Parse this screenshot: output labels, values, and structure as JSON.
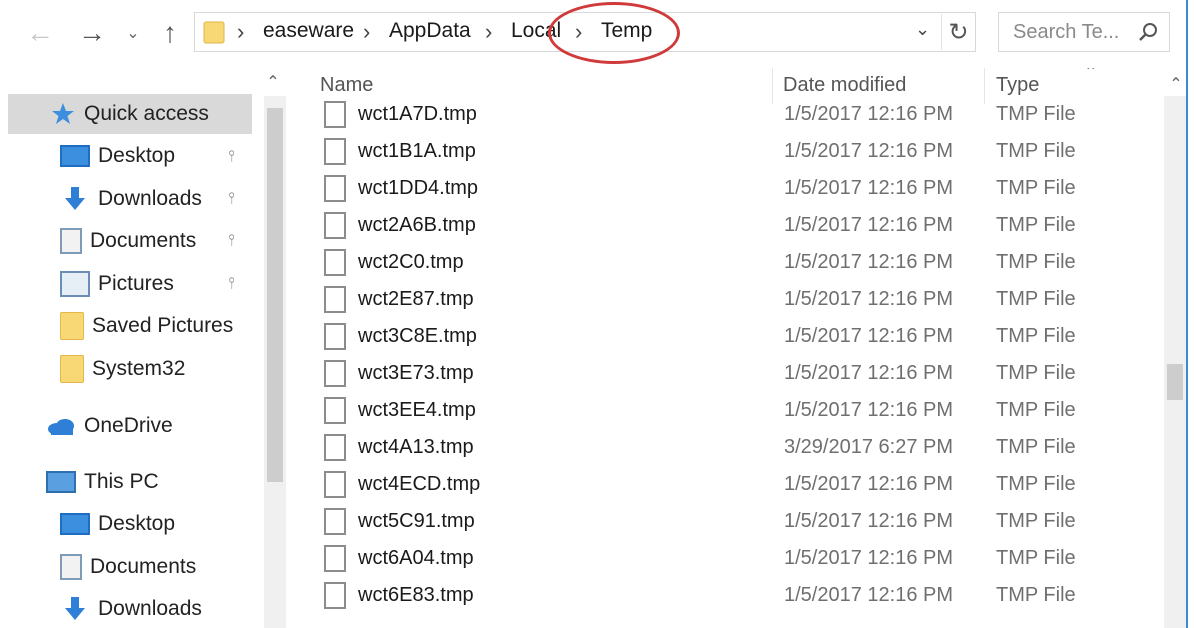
{
  "nav_buttons": {
    "back": "←",
    "forward": "→",
    "recent": "⌄",
    "up": "↑"
  },
  "address": {
    "crumbs": [
      "easeware",
      "AppData",
      "Local",
      "Temp"
    ],
    "separator": "›",
    "dropdown": "⌄",
    "refresh": "↻",
    "highlight_color": "#d03a3a"
  },
  "search": {
    "placeholder": "Search Te..."
  },
  "sidebar": {
    "quick_access": "Quick access",
    "items": [
      {
        "label": "Desktop",
        "icon": "desktop-icon",
        "pinned": true
      },
      {
        "label": "Downloads",
        "icon": "download-arrow-icon",
        "pinned": true
      },
      {
        "label": "Documents",
        "icon": "document-icon",
        "pinned": true
      },
      {
        "label": "Pictures",
        "icon": "pictures-icon",
        "pinned": true
      },
      {
        "label": "Saved Pictures",
        "icon": "folder-icon",
        "pinned": false
      },
      {
        "label": "System32",
        "icon": "folder-icon",
        "pinned": false
      }
    ],
    "onedrive": "OneDrive",
    "this_pc": "This PC",
    "pc_items": [
      {
        "label": "Desktop",
        "icon": "desktop-icon"
      },
      {
        "label": "Documents",
        "icon": "document-icon"
      },
      {
        "label": "Downloads",
        "icon": "download-arrow-icon"
      }
    ],
    "pin_glyph": "📌"
  },
  "columns": {
    "name": "Name",
    "date": "Date modified",
    "type": "Type"
  },
  "files": [
    {
      "name": "wct1A7D.tmp",
      "date": "1/5/2017 12:16 PM",
      "type": "TMP File"
    },
    {
      "name": "wct1B1A.tmp",
      "date": "1/5/2017 12:16 PM",
      "type": "TMP File"
    },
    {
      "name": "wct1DD4.tmp",
      "date": "1/5/2017 12:16 PM",
      "type": "TMP File"
    },
    {
      "name": "wct2A6B.tmp",
      "date": "1/5/2017 12:16 PM",
      "type": "TMP File"
    },
    {
      "name": "wct2C0.tmp",
      "date": "1/5/2017 12:16 PM",
      "type": "TMP File"
    },
    {
      "name": "wct2E87.tmp",
      "date": "1/5/2017 12:16 PM",
      "type": "TMP File"
    },
    {
      "name": "wct3C8E.tmp",
      "date": "1/5/2017 12:16 PM",
      "type": "TMP File"
    },
    {
      "name": "wct3E73.tmp",
      "date": "1/5/2017 12:16 PM",
      "type": "TMP File"
    },
    {
      "name": "wct3EE4.tmp",
      "date": "1/5/2017 12:16 PM",
      "type": "TMP File"
    },
    {
      "name": "wct4A13.tmp",
      "date": "3/29/2017 6:27 PM",
      "type": "TMP File"
    },
    {
      "name": "wct4ECD.tmp",
      "date": "1/5/2017 12:16 PM",
      "type": "TMP File"
    },
    {
      "name": "wct5C91.tmp",
      "date": "1/5/2017 12:16 PM",
      "type": "TMP File"
    },
    {
      "name": "wct6A04.tmp",
      "date": "1/5/2017 12:16 PM",
      "type": "TMP File"
    },
    {
      "name": "wct6E83.tmp",
      "date": "1/5/2017 12:16 PM",
      "type": "TMP File"
    }
  ]
}
